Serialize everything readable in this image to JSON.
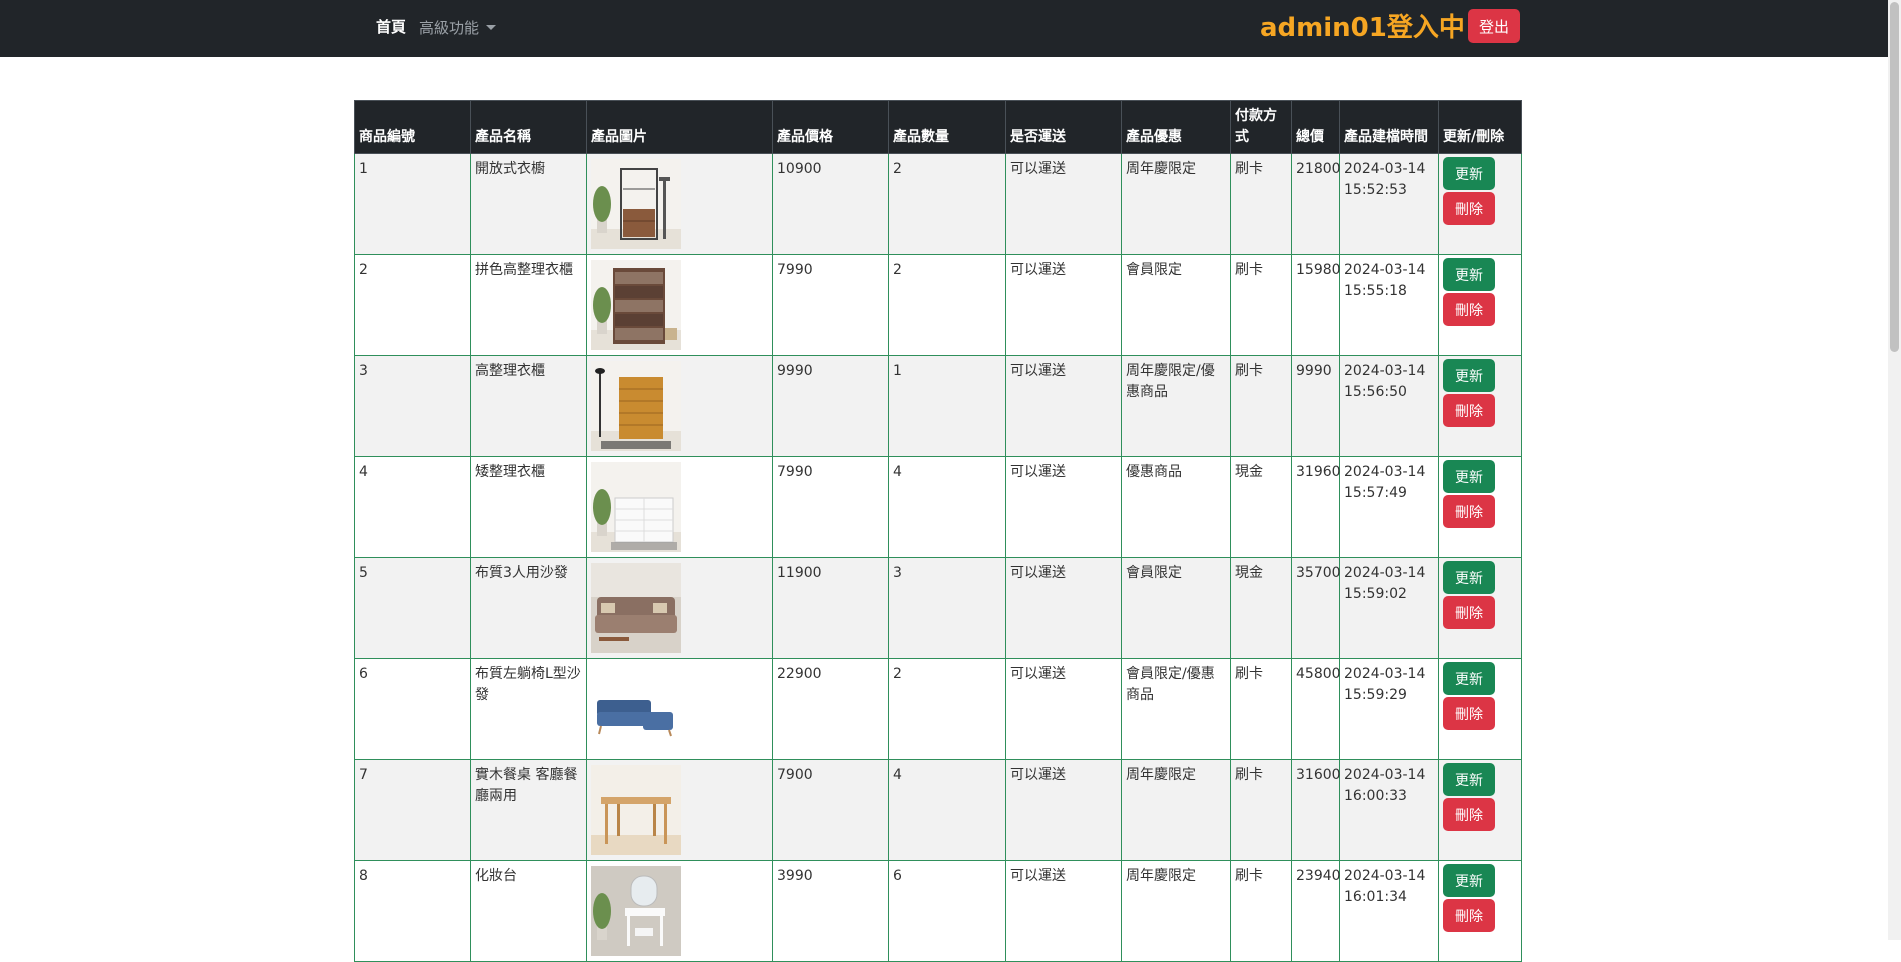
{
  "navbar": {
    "home_label": "首頁",
    "advanced_label": "高級功能",
    "login_status": "admin01登入中!",
    "logout_label": "登出"
  },
  "table": {
    "headers": [
      "商品編號",
      "產品名稱",
      "產品圖片",
      "產品價格",
      "產品數量",
      "是否運送",
      "產品優惠",
      "付款方式",
      "總價",
      "產品建檔時間",
      "更新/刪除"
    ],
    "update_label": "更新",
    "delete_label": "刪除",
    "rows": [
      {
        "id": "1",
        "name": "開放式衣櫥",
        "image": "open-wardrobe-shelf",
        "price": "10900",
        "qty": "2",
        "shipping": "可以運送",
        "promo": "周年慶限定",
        "payment": "刷卡",
        "total": "21800",
        "created": "2024-03-14 15:52:53"
      },
      {
        "id": "2",
        "name": "拼色高整理衣櫃",
        "image": "two-tone-tall-drawer-chest",
        "price": "7990",
        "qty": "2",
        "shipping": "可以運送",
        "promo": "會員限定",
        "payment": "刷卡",
        "total": "15980",
        "created": "2024-03-14 15:55:18"
      },
      {
        "id": "3",
        "name": "高整理衣櫃",
        "image": "tall-wooden-drawer-chest",
        "price": "9990",
        "qty": "1",
        "shipping": "可以運送",
        "promo": "周年慶限定/優惠商品",
        "payment": "刷卡",
        "total": "9990",
        "created": "2024-03-14 15:56:50"
      },
      {
        "id": "4",
        "name": "矮整理衣櫃",
        "image": "low-white-drawer-chest",
        "price": "7990",
        "qty": "4",
        "shipping": "可以運送",
        "promo": "優惠商品",
        "payment": "現金",
        "total": "31960",
        "created": "2024-03-14 15:57:49"
      },
      {
        "id": "5",
        "name": "布質3人用沙發",
        "image": "fabric-3-seat-sofa",
        "price": "11900",
        "qty": "3",
        "shipping": "可以運送",
        "promo": "會員限定",
        "payment": "現金",
        "total": "35700",
        "created": "2024-03-14 15:59:02"
      },
      {
        "id": "6",
        "name": "布質左躺椅L型沙發",
        "image": "blue-l-shaped-sofa",
        "price": "22900",
        "qty": "2",
        "shipping": "可以運送",
        "promo": "會員限定/優惠商品",
        "payment": "刷卡",
        "total": "45800",
        "created": "2024-03-14 15:59:29"
      },
      {
        "id": "7",
        "name": "實木餐桌 客廳餐廳兩用",
        "image": "solid-wood-dining-table",
        "price": "7900",
        "qty": "4",
        "shipping": "可以運送",
        "promo": "周年慶限定",
        "payment": "刷卡",
        "total": "31600",
        "created": "2024-03-14 16:00:33"
      },
      {
        "id": "8",
        "name": "化妝台",
        "image": "white-dressing-table",
        "price": "3990",
        "qty": "6",
        "shipping": "可以運送",
        "promo": "周年慶限定",
        "payment": "刷卡",
        "total": "23940",
        "created": "2024-03-14 16:01:34"
      }
    ]
  }
}
